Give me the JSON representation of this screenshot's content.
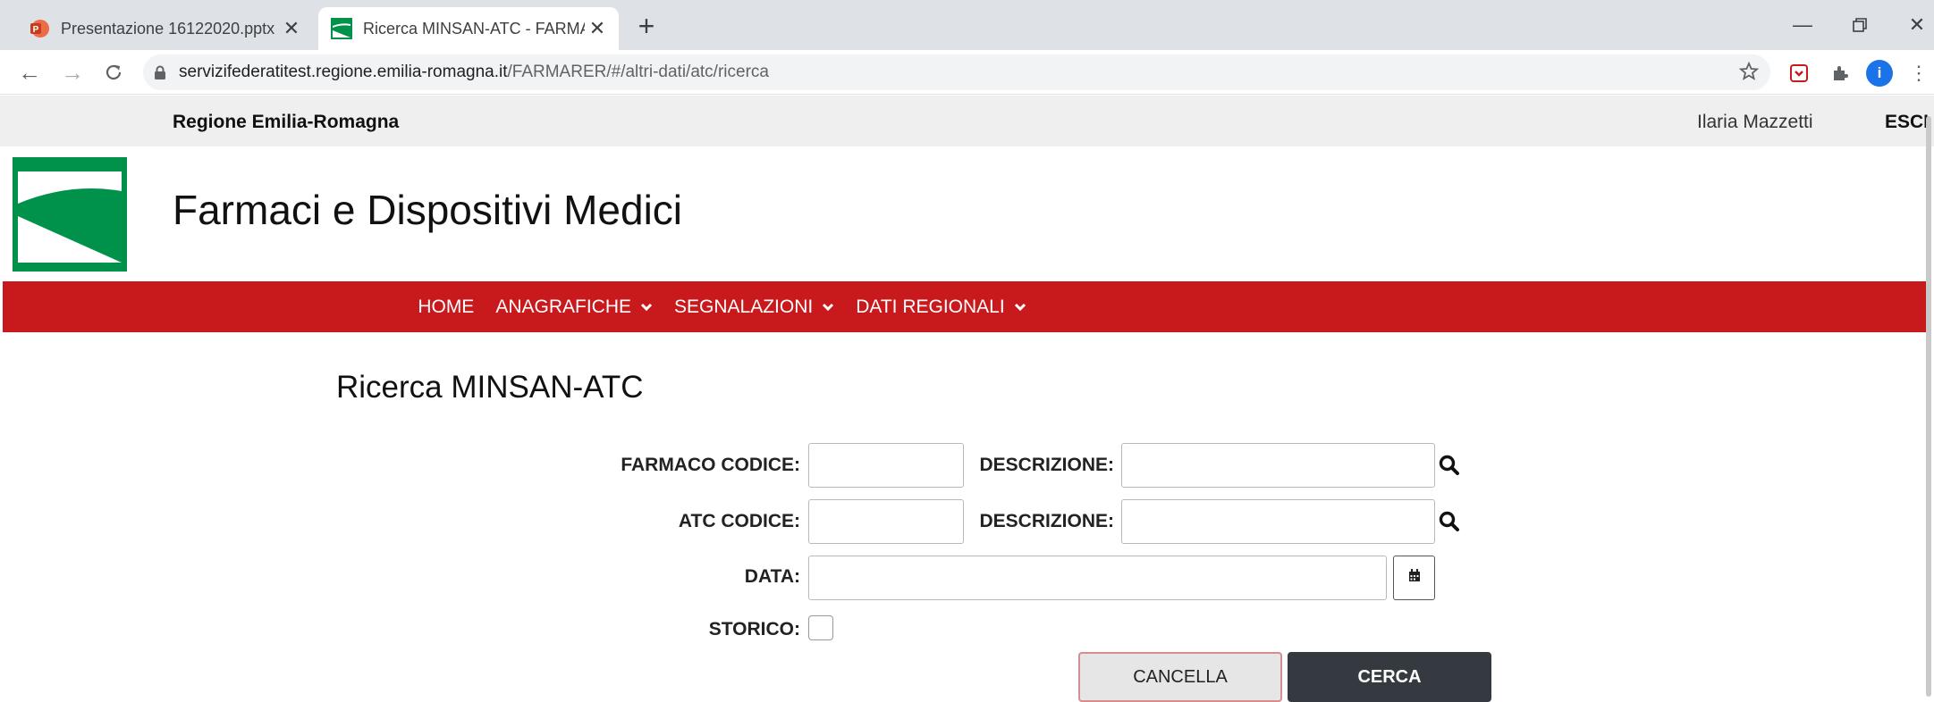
{
  "browser": {
    "tabs": [
      {
        "title": "Presentazione 16122020.pptx",
        "icon": "powerpoint-icon",
        "active": false
      },
      {
        "title": "Ricerca MINSAN-ATC - FARMARER",
        "icon": "region-logo-icon",
        "active": true
      }
    ],
    "url": {
      "host": "servizifederatitest.regione.emilia-romagna.it",
      "path": "/FARMARER/#/altri-dati/atc/ricerca"
    },
    "profile_initial": "i"
  },
  "topbar": {
    "region": "Regione Emilia-Romagna",
    "user": "Ilaria Mazzetti",
    "logout": "ESCI"
  },
  "header": {
    "title": "Farmaci e Dispositivi Medici"
  },
  "nav": {
    "items": [
      {
        "label": "HOME",
        "dropdown": false
      },
      {
        "label": "ANAGRAFICHE",
        "dropdown": true
      },
      {
        "label": "SEGNALAZIONI",
        "dropdown": true
      },
      {
        "label": "DATI REGIONALI",
        "dropdown": true
      }
    ]
  },
  "page": {
    "heading": "Ricerca MINSAN-ATC"
  },
  "form": {
    "farmaco_codice_label": "FARMACO CODICE:",
    "farmaco_descrizione_label": "DESCRIZIONE:",
    "atc_codice_label": "ATC CODICE:",
    "atc_descrizione_label": "DESCRIZIONE:",
    "data_label": "DATA:",
    "storico_label": "STORICO:",
    "farmaco_codice_value": "",
    "farmaco_descrizione_value": "",
    "atc_codice_value": "",
    "atc_descrizione_value": "",
    "data_value": "",
    "storico_checked": false
  },
  "buttons": {
    "cancel": "CANCELLA",
    "search": "CERCA"
  },
  "colors": {
    "nav_red": "#c8191d",
    "brand_green": "#00924a",
    "search_button": "#343a40"
  }
}
